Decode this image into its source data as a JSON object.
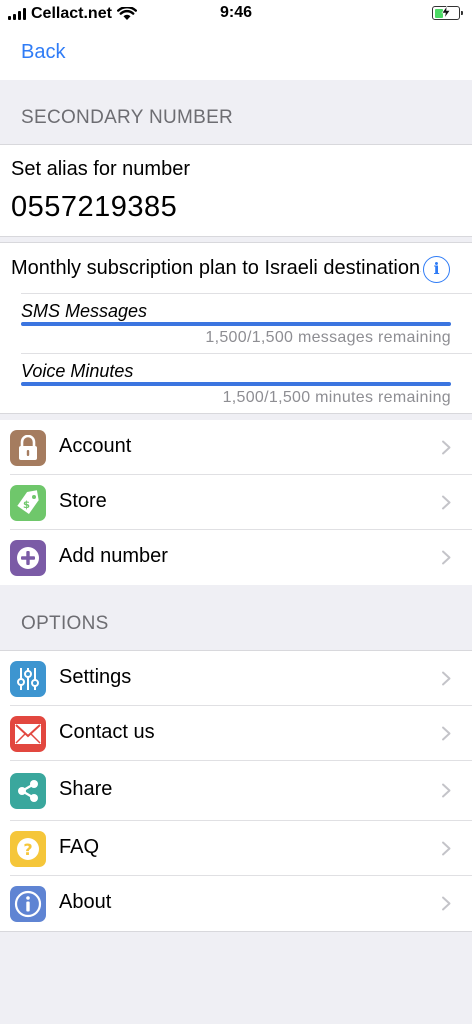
{
  "status": {
    "carrier": "Cellact.net",
    "time": "9:46"
  },
  "nav": {
    "back_label": "Back"
  },
  "secondary": {
    "header": "SECONDARY NUMBER",
    "alias_label": "Set alias for number",
    "number": "0557219385"
  },
  "plan": {
    "title": "Monthly subscription plan to Israeli destinations",
    "usage": [
      {
        "label": "SMS Messages",
        "remaining_text": "1,500/1,500 messages remaining",
        "fraction_remaining": 1.0
      },
      {
        "label": "Voice Minutes",
        "remaining_text": "1,500/1,500 minutes remaining",
        "fraction_remaining": 1.0
      }
    ]
  },
  "account_menu": [
    {
      "label": "Account",
      "icon": "lock-icon",
      "color": "#a57c5f"
    },
    {
      "label": "Store",
      "icon": "price-tag-icon",
      "color": "#6fc76b"
    },
    {
      "label": "Add number",
      "icon": "plus-circle-icon",
      "color": "#7b5ba6"
    }
  ],
  "options": {
    "header": "OPTIONS",
    "items": [
      {
        "label": "Settings",
        "icon": "sliders-icon",
        "color": "#3d95d0"
      },
      {
        "label": "Contact us",
        "icon": "envelope-icon",
        "color": "#e2473f"
      },
      {
        "label": "Share",
        "icon": "share-icon",
        "color": "#3aa79d"
      },
      {
        "label": "FAQ",
        "icon": "question-icon",
        "color": "#f5c63a"
      },
      {
        "label": "About",
        "icon": "info-icon",
        "color": "#5f84d3"
      }
    ]
  }
}
